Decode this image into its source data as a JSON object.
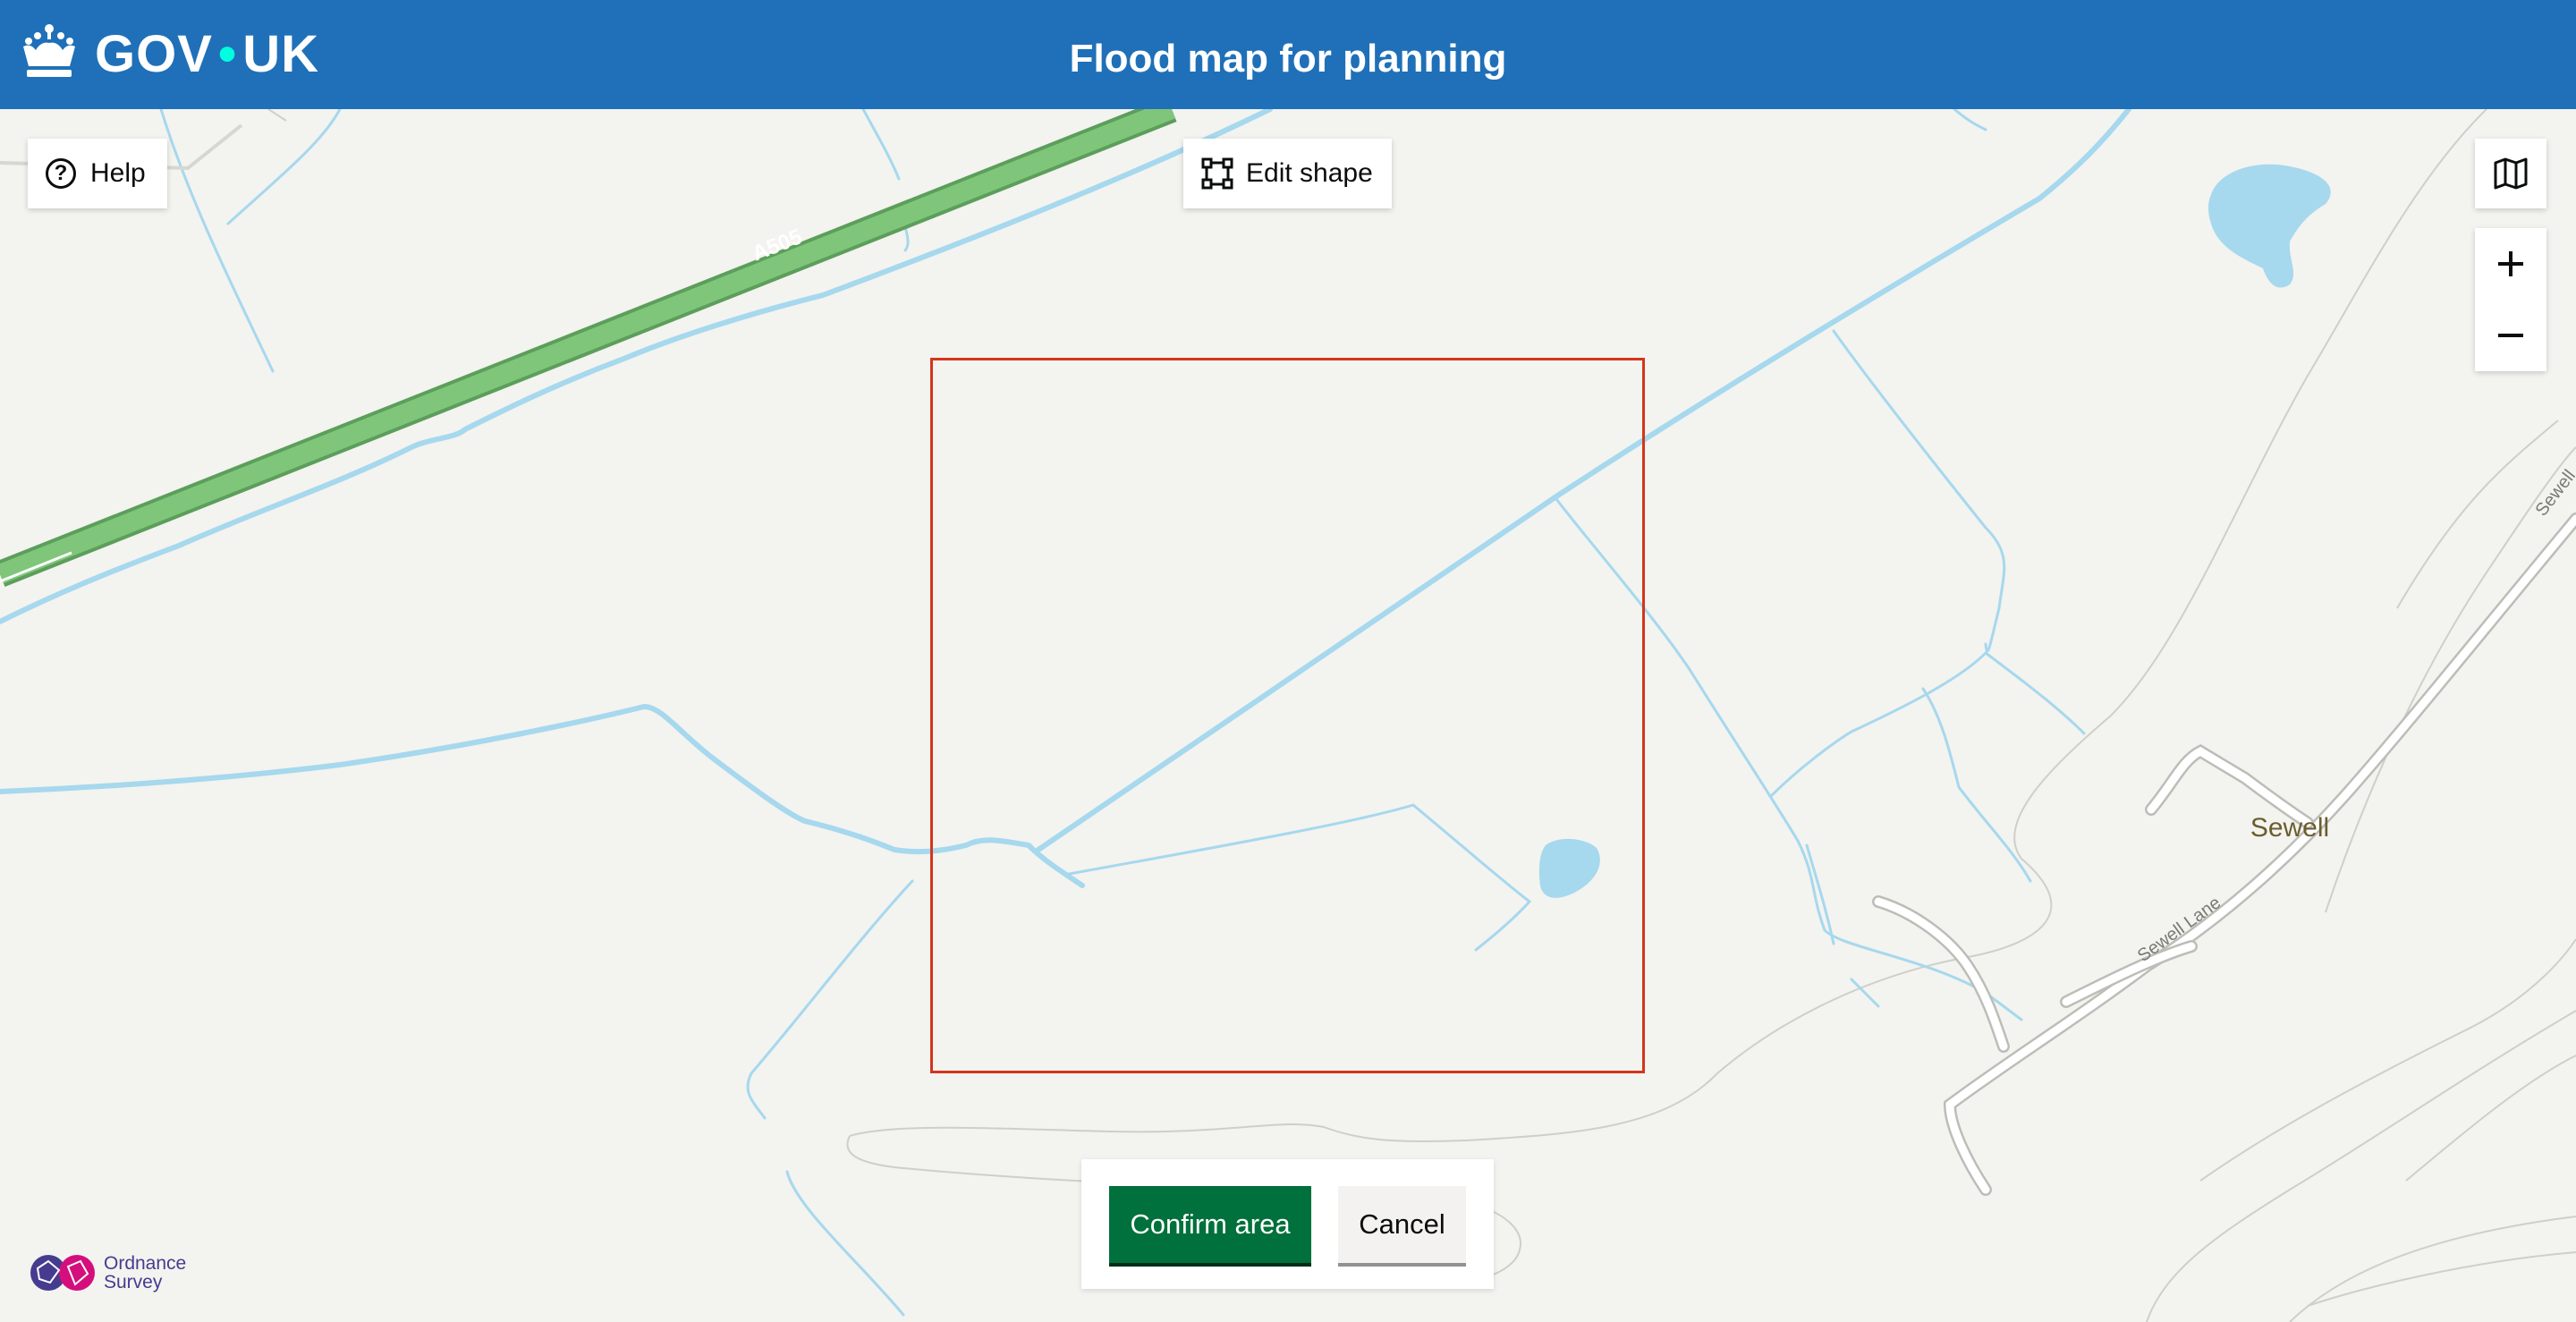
{
  "header": {
    "logo_text_left": "GOV",
    "logo_text_right": "UK",
    "service_title": "Flood map for planning"
  },
  "map": {
    "labels": {
      "road": "A505",
      "village": "Sewell",
      "lane": "Sewell Lane",
      "lane_cut": "Sewell"
    },
    "colors": {
      "background": "#f3f3ef",
      "water": "#a6d8ee",
      "road_major": "#7fc67a",
      "selection": "#d4351c"
    }
  },
  "controls": {
    "help_label": "Help",
    "edit_shape_label": "Edit shape",
    "layers_icon": "map-icon",
    "zoom_in_icon": "plus-icon",
    "zoom_out_icon": "minus-icon",
    "confirm_label": "Confirm area",
    "cancel_label": "Cancel"
  },
  "attribution": {
    "line1": "Ordnance",
    "line2": "Survey"
  },
  "theme": {
    "header_blue": "#1f70b8",
    "confirm_green": "#00703c"
  }
}
